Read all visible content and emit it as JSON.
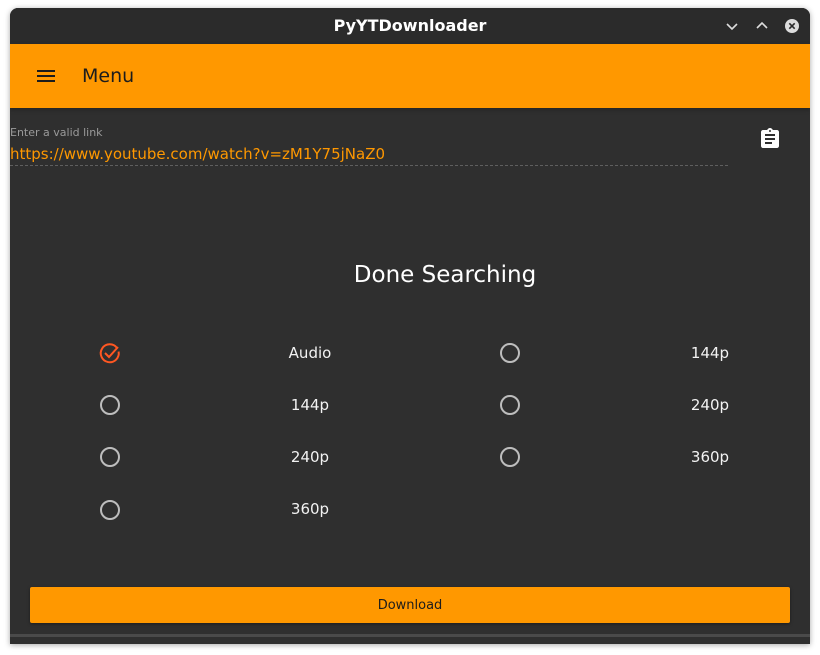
{
  "window": {
    "title": "PyYTDownloader",
    "controls": [
      "minimize",
      "maximize",
      "close"
    ]
  },
  "appbar": {
    "menu_label": "Menu",
    "menu_icon": "hamburger-menu-icon"
  },
  "link": {
    "label": "Enter a valid link",
    "value": "https://www.youtube.com/watch?v=zM1Y75jNaZ0",
    "paste_icon": "clipboard-icon"
  },
  "status_text": "Done Searching",
  "options": {
    "left": [
      {
        "label": "Audio",
        "selected": true
      },
      {
        "label": "144p",
        "selected": false
      },
      {
        "label": "240p",
        "selected": false
      },
      {
        "label": "360p",
        "selected": false
      }
    ],
    "right": [
      {
        "label": "144p",
        "selected": false
      },
      {
        "label": "240p",
        "selected": false
      },
      {
        "label": "360p",
        "selected": false
      }
    ]
  },
  "download_label": "Download",
  "colors": {
    "accent": "#ff9800",
    "selected_radio": "#ff5722",
    "background": "#2f2f2f",
    "titlebar": "#2b2b2b"
  }
}
